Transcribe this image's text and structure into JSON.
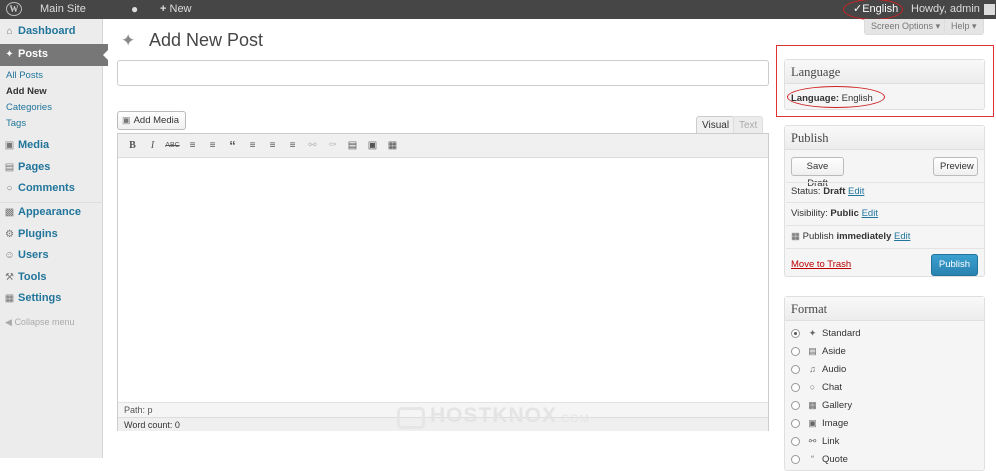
{
  "adminbar": {
    "site": "Main Site",
    "new_label": "New",
    "lang": "English",
    "howdy": "Howdy, admin"
  },
  "screen_options": "Screen Options",
  "help": "Help",
  "sidebar": {
    "dashboard": "Dashboard",
    "posts": "Posts",
    "all_posts": "All Posts",
    "add_new": "Add New",
    "categories": "Categories",
    "tags": "Tags",
    "media": "Media",
    "pages": "Pages",
    "comments": "Comments",
    "appearance": "Appearance",
    "plugins": "Plugins",
    "users": "Users",
    "tools": "Tools",
    "settings": "Settings",
    "collapse": "Collapse menu"
  },
  "page_title": "Add New Post",
  "editor": {
    "add_media": "Add Media",
    "tab_visual": "Visual",
    "tab_text": "Text",
    "path": "Path: p",
    "word_count": "Word count: 0"
  },
  "watermark": {
    "text": "HOSTKNOX",
    "suffix": ".COM"
  },
  "language_box": {
    "title": "Language",
    "label": "Language:",
    "value": "English"
  },
  "publish_box": {
    "title": "Publish",
    "save_draft": "Save Draft",
    "preview": "Preview",
    "status_label": "Status:",
    "status_value": "Draft",
    "edit": "Edit",
    "visibility_label": "Visibility:",
    "visibility_value": "Public",
    "publish_label": "Publish",
    "publish_value": "immediately",
    "trash": "Move to Trash",
    "publish_button": "Publish"
  },
  "format_box": {
    "title": "Format",
    "options": [
      "Standard",
      "Aside",
      "Audio",
      "Chat",
      "Gallery",
      "Image",
      "Link",
      "Quote"
    ],
    "selected": "Standard"
  },
  "colors": {
    "adminbar": "#464646",
    "link": "#21759b",
    "primary_button": "#2e8cb8",
    "highlight": "#d33333"
  }
}
